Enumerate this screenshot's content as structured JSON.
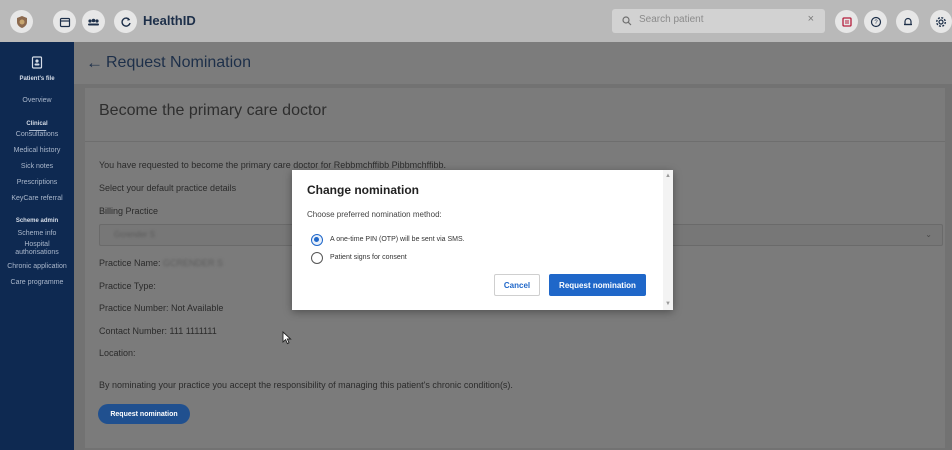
{
  "header": {
    "app_title": "HealthID",
    "search": {
      "placeholder": "Search patient",
      "clear": "×"
    }
  },
  "sidebar": {
    "file_label": "Patient's file",
    "items": [
      {
        "label": "Overview"
      },
      {
        "label": "Clinical"
      },
      {
        "label": "Consultations"
      },
      {
        "label": "Medical history"
      },
      {
        "label": "Sick notes"
      },
      {
        "label": "Prescriptions"
      },
      {
        "label": "KeyCare referral"
      },
      {
        "label": "Scheme admin"
      },
      {
        "label": "Scheme info"
      },
      {
        "label": "Hospital authorisations"
      },
      {
        "label": "Chronic application"
      },
      {
        "label": "Care programme"
      }
    ]
  },
  "page": {
    "back_arrow": "←",
    "title": "Request Nomination",
    "card_title": "Become the primary care doctor",
    "requested_text": "You have requested to become the primary care doctor for Rebbmchffibb Pibbmchffibb.",
    "select_default": "Select your default practice details",
    "billing_label": "Billing Practice",
    "billing_value": "Gcrender S",
    "billing_chevron": "⌄",
    "practice_name_label": "Practice Name:",
    "practice_name_value": "GCRENDER S",
    "practice_type": "Practice Type:",
    "practice_number": "Practice Number: Not Available",
    "contact_number": "Contact Number: 111 1111111",
    "location": "Location:",
    "accept_text": "By nominating your practice you accept the responsibility of managing this patient's chronic condition(s).",
    "request_button": "Request nomination"
  },
  "modal": {
    "title": "Change nomination",
    "subtitle": "Choose preferred nomination method:",
    "options": [
      {
        "label": "A one-time PIN (OTP) will be sent via SMS.",
        "selected": true
      },
      {
        "label": "Patient signs for consent",
        "selected": false
      }
    ],
    "cancel": "Cancel",
    "confirm": "Request nomination",
    "scroll_up": "▲",
    "scroll_down": "▼"
  },
  "colors": {
    "sidebar_bg": "#0e2951",
    "primary": "#1f67c9",
    "overlay_main": "#727272",
    "topbar": "#b9b9b9"
  },
  "icons": [
    "logo-shield-icon",
    "calendar-icon",
    "team-icon",
    "refresh-icon",
    "search-icon",
    "close-icon",
    "message-icon",
    "help-icon",
    "bell-icon",
    "settings-icon",
    "patient-file-icon",
    "back-arrow-icon",
    "chevron-down-icon",
    "cursor-icon"
  ]
}
